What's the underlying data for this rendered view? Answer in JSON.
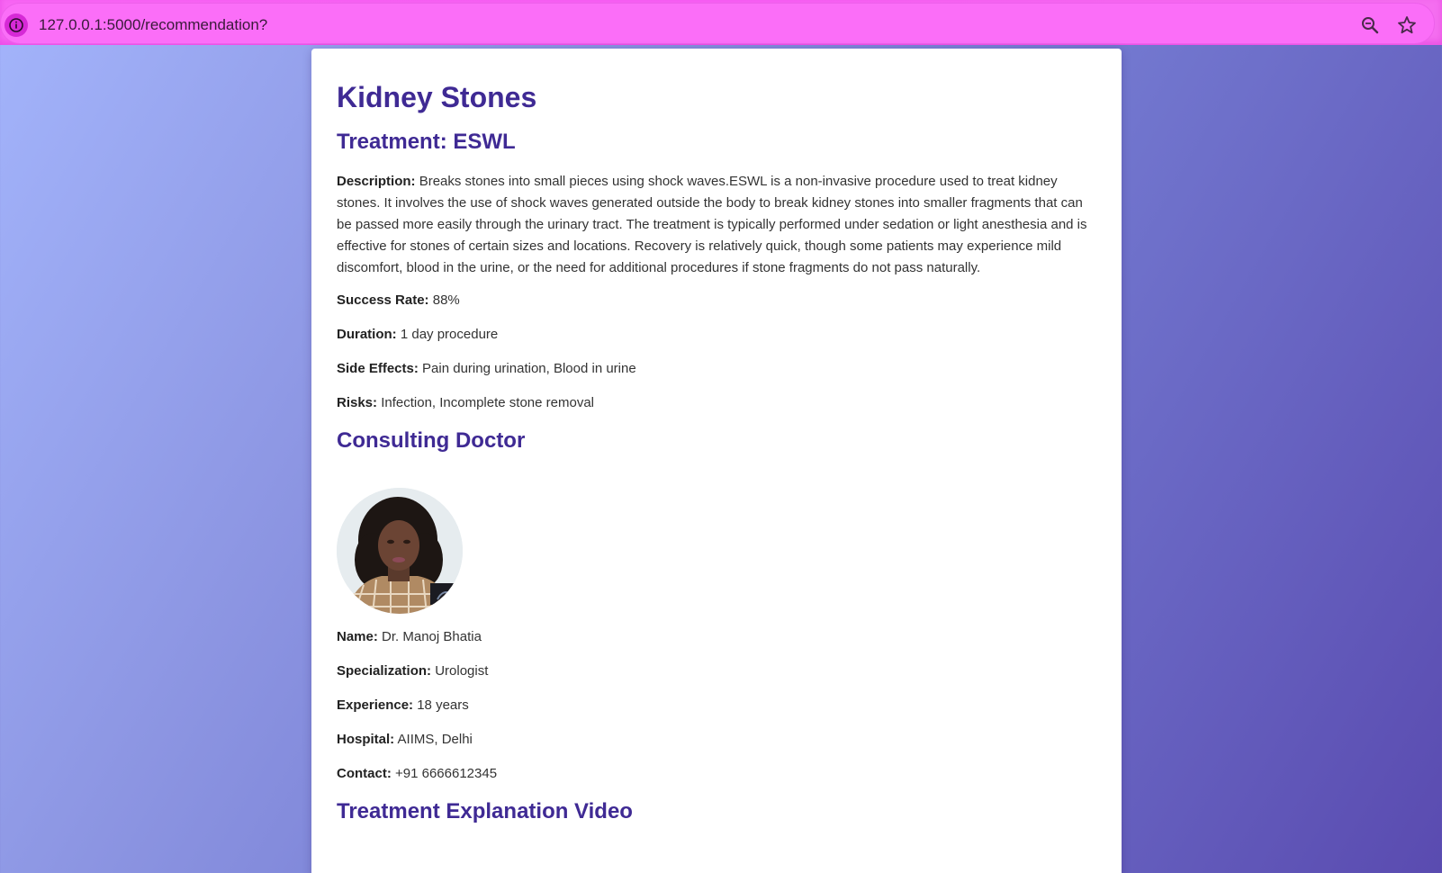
{
  "browser": {
    "url": "127.0.0.1:5000/recommendation?",
    "theme_color": "#f866f4"
  },
  "page": {
    "title": "Kidney Stones",
    "treatment_heading": "Treatment: ESWL",
    "treatment": {
      "description_label": "Description:",
      "description": "Breaks stones into small pieces using shock waves.ESWL is a non-invasive procedure used to treat kidney stones. It involves the use of shock waves generated outside the body to break kidney stones into smaller fragments that can be passed more easily through the urinary tract. The treatment is typically performed under sedation or light anesthesia and is effective for stones of certain sizes and locations. Recovery is relatively quick, though some patients may experience mild discomfort, blood in the urine, or the need for additional procedures if stone fragments do not pass naturally.",
      "success_rate_label": "Success Rate:",
      "success_rate": "88%",
      "duration_label": "Duration:",
      "duration": "1 day procedure",
      "side_effects_label": "Side Effects:",
      "side_effects": "Pain during urination, Blood in urine",
      "risks_label": "Risks:",
      "risks": "Infection, Incomplete stone removal"
    },
    "doctor_heading": "Consulting Doctor",
    "doctor": {
      "photo_icon": "doctor-avatar",
      "name_label": "Name:",
      "name": "Dr. Manoj Bhatia",
      "specialization_label": "Specialization:",
      "specialization": "Urologist",
      "experience_label": "Experience:",
      "experience": "18 years",
      "hospital_label": "Hospital:",
      "hospital": "AIIMS, Delhi",
      "contact_label": "Contact:",
      "contact": "+91 6666612345"
    },
    "video_heading": "Treatment Explanation Video"
  },
  "colors": {
    "heading": "#3f2a94",
    "background_start": "#a3b4fb",
    "background_end": "#5a4bb0"
  }
}
